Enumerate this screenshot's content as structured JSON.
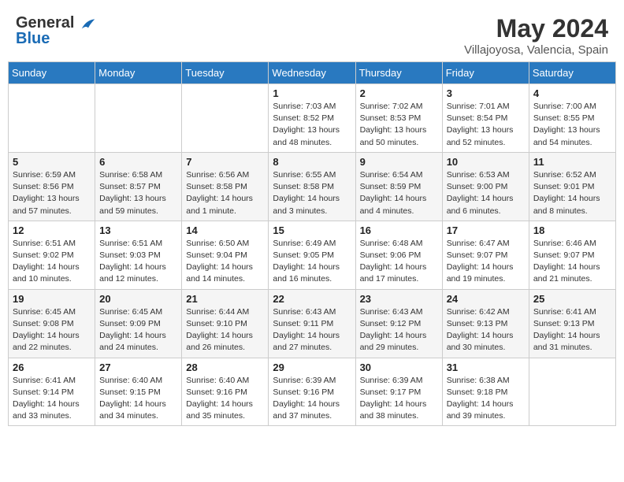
{
  "header": {
    "logo_line1": "General",
    "logo_line2": "Blue",
    "title": "May 2024",
    "subtitle": "Villajoyosa, Valencia, Spain"
  },
  "calendar": {
    "days_of_week": [
      "Sunday",
      "Monday",
      "Tuesday",
      "Wednesday",
      "Thursday",
      "Friday",
      "Saturday"
    ],
    "weeks": [
      [
        {
          "day": "",
          "info": ""
        },
        {
          "day": "",
          "info": ""
        },
        {
          "day": "",
          "info": ""
        },
        {
          "day": "1",
          "info": "Sunrise: 7:03 AM\nSunset: 8:52 PM\nDaylight: 13 hours\nand 48 minutes."
        },
        {
          "day": "2",
          "info": "Sunrise: 7:02 AM\nSunset: 8:53 PM\nDaylight: 13 hours\nand 50 minutes."
        },
        {
          "day": "3",
          "info": "Sunrise: 7:01 AM\nSunset: 8:54 PM\nDaylight: 13 hours\nand 52 minutes."
        },
        {
          "day": "4",
          "info": "Sunrise: 7:00 AM\nSunset: 8:55 PM\nDaylight: 13 hours\nand 54 minutes."
        }
      ],
      [
        {
          "day": "5",
          "info": "Sunrise: 6:59 AM\nSunset: 8:56 PM\nDaylight: 13 hours\nand 57 minutes."
        },
        {
          "day": "6",
          "info": "Sunrise: 6:58 AM\nSunset: 8:57 PM\nDaylight: 13 hours\nand 59 minutes."
        },
        {
          "day": "7",
          "info": "Sunrise: 6:56 AM\nSunset: 8:58 PM\nDaylight: 14 hours\nand 1 minute."
        },
        {
          "day": "8",
          "info": "Sunrise: 6:55 AM\nSunset: 8:58 PM\nDaylight: 14 hours\nand 3 minutes."
        },
        {
          "day": "9",
          "info": "Sunrise: 6:54 AM\nSunset: 8:59 PM\nDaylight: 14 hours\nand 4 minutes."
        },
        {
          "day": "10",
          "info": "Sunrise: 6:53 AM\nSunset: 9:00 PM\nDaylight: 14 hours\nand 6 minutes."
        },
        {
          "day": "11",
          "info": "Sunrise: 6:52 AM\nSunset: 9:01 PM\nDaylight: 14 hours\nand 8 minutes."
        }
      ],
      [
        {
          "day": "12",
          "info": "Sunrise: 6:51 AM\nSunset: 9:02 PM\nDaylight: 14 hours\nand 10 minutes."
        },
        {
          "day": "13",
          "info": "Sunrise: 6:51 AM\nSunset: 9:03 PM\nDaylight: 14 hours\nand 12 minutes."
        },
        {
          "day": "14",
          "info": "Sunrise: 6:50 AM\nSunset: 9:04 PM\nDaylight: 14 hours\nand 14 minutes."
        },
        {
          "day": "15",
          "info": "Sunrise: 6:49 AM\nSunset: 9:05 PM\nDaylight: 14 hours\nand 16 minutes."
        },
        {
          "day": "16",
          "info": "Sunrise: 6:48 AM\nSunset: 9:06 PM\nDaylight: 14 hours\nand 17 minutes."
        },
        {
          "day": "17",
          "info": "Sunrise: 6:47 AM\nSunset: 9:07 PM\nDaylight: 14 hours\nand 19 minutes."
        },
        {
          "day": "18",
          "info": "Sunrise: 6:46 AM\nSunset: 9:07 PM\nDaylight: 14 hours\nand 21 minutes."
        }
      ],
      [
        {
          "day": "19",
          "info": "Sunrise: 6:45 AM\nSunset: 9:08 PM\nDaylight: 14 hours\nand 22 minutes."
        },
        {
          "day": "20",
          "info": "Sunrise: 6:45 AM\nSunset: 9:09 PM\nDaylight: 14 hours\nand 24 minutes."
        },
        {
          "day": "21",
          "info": "Sunrise: 6:44 AM\nSunset: 9:10 PM\nDaylight: 14 hours\nand 26 minutes."
        },
        {
          "day": "22",
          "info": "Sunrise: 6:43 AM\nSunset: 9:11 PM\nDaylight: 14 hours\nand 27 minutes."
        },
        {
          "day": "23",
          "info": "Sunrise: 6:43 AM\nSunset: 9:12 PM\nDaylight: 14 hours\nand 29 minutes."
        },
        {
          "day": "24",
          "info": "Sunrise: 6:42 AM\nSunset: 9:13 PM\nDaylight: 14 hours\nand 30 minutes."
        },
        {
          "day": "25",
          "info": "Sunrise: 6:41 AM\nSunset: 9:13 PM\nDaylight: 14 hours\nand 31 minutes."
        }
      ],
      [
        {
          "day": "26",
          "info": "Sunrise: 6:41 AM\nSunset: 9:14 PM\nDaylight: 14 hours\nand 33 minutes."
        },
        {
          "day": "27",
          "info": "Sunrise: 6:40 AM\nSunset: 9:15 PM\nDaylight: 14 hours\nand 34 minutes."
        },
        {
          "day": "28",
          "info": "Sunrise: 6:40 AM\nSunset: 9:16 PM\nDaylight: 14 hours\nand 35 minutes."
        },
        {
          "day": "29",
          "info": "Sunrise: 6:39 AM\nSunset: 9:16 PM\nDaylight: 14 hours\nand 37 minutes."
        },
        {
          "day": "30",
          "info": "Sunrise: 6:39 AM\nSunset: 9:17 PM\nDaylight: 14 hours\nand 38 minutes."
        },
        {
          "day": "31",
          "info": "Sunrise: 6:38 AM\nSunset: 9:18 PM\nDaylight: 14 hours\nand 39 minutes."
        },
        {
          "day": "",
          "info": ""
        }
      ]
    ]
  }
}
